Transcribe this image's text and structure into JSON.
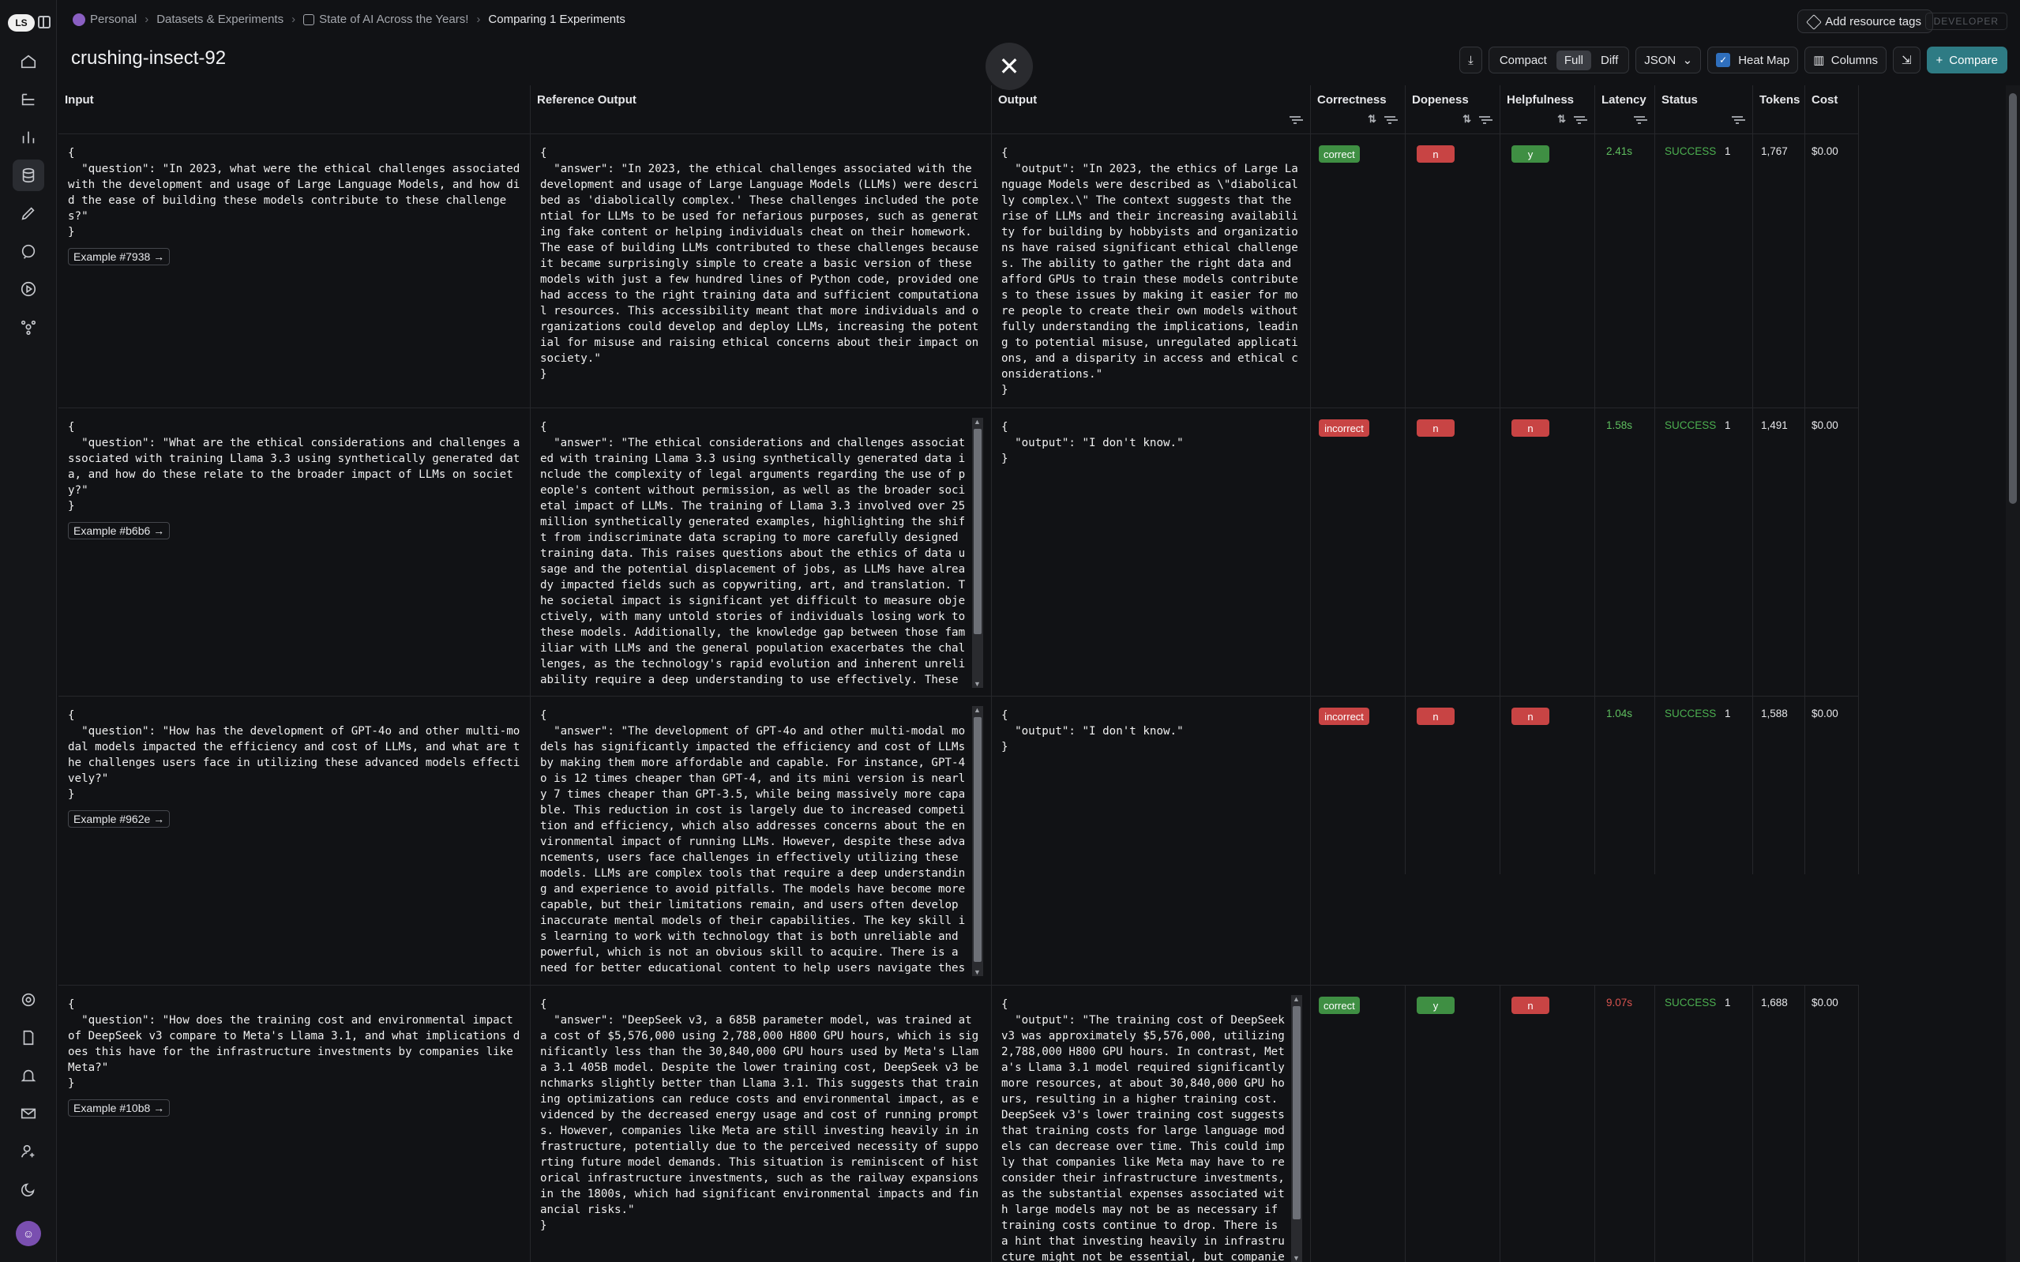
{
  "breadcrumb": {
    "workspace": "Personal",
    "section": "Datasets & Experiments",
    "dataset": "State of AI Across the Years!",
    "current": "Comparing 1 Experiments"
  },
  "header": {
    "add_tags": "Add resource tags",
    "developer": "DEVELOPER",
    "title": "crushing-insect-92"
  },
  "toolbar": {
    "compact": "Compact",
    "full": "Full",
    "diff": "Diff",
    "format": "JSON",
    "heatmap": "Heat Map",
    "columns": "Columns",
    "compare": "Compare"
  },
  "columns": {
    "input": "Input",
    "reference": "Reference Output",
    "output": "Output",
    "correctness": "Correctness",
    "dopeness": "Dopeness",
    "helpfulness": "Helpfulness",
    "latency": "Latency",
    "status": "Status",
    "tokens": "Tokens",
    "cost": "Cost"
  },
  "rows": [
    {
      "input": "{\n  \"question\": \"In 2023, what were the ethical challenges associated with the development and usage of Large Language Models, and how did the ease of building these models contribute to these challenges?\"\n}",
      "example": "Example #7938 →",
      "reference": "{\n  \"answer\": \"In 2023, the ethical challenges associated with the development and usage of Large Language Models (LLMs) were described as 'diabolically complex.' These challenges included the potential for LLMs to be used for nefarious purposes, such as generating fake content or helping individuals cheat on their homework. The ease of building LLMs contributed to these challenges because it became surprisingly simple to create a basic version of these models with just a few hundred lines of Python code, provided one had access to the right training data and sufficient computational resources. This accessibility meant that more individuals and organizations could develop and deploy LLMs, increasing the potential for misuse and raising ethical concerns about their impact on society.\"\n}",
      "output": "{\n  \"output\": \"In 2023, the ethics of Large Language Models were described as \\\"diabolically complex.\\\" The context suggests that the rise of LLMs and their increasing availability for building by hobbyists and organizations have raised significant ethical challenges. The ability to gather the right data and afford GPUs to train these models contributes to these issues by making it easier for more people to create their own models without fully understanding the implications, leading to potential misuse, unregulated applications, and a disparity in access and ethical considerations.\"\n}",
      "correctness": "correct",
      "dopeness": "n",
      "helpfulness": "y",
      "latency": "2.41s",
      "status": "SUCCESS",
      "status_count": "1",
      "tokens": "1,767",
      "cost": "$0.00"
    },
    {
      "input": "{\n  \"question\": \"What are the ethical considerations and challenges associated with training Llama 3.3 using synthetically generated data, and how do these relate to the broader impact of LLMs on society?\"\n}",
      "example": "Example #b6b6 →",
      "reference": "{\n  \"answer\": \"The ethical considerations and challenges associated with training Llama 3.3 using synthetically generated data include the complexity of legal arguments regarding the use of people's content without permission, as well as the broader societal impact of LLMs. The training of Llama 3.3 involved over 25 million synthetically generated examples, highlighting the shift from indiscriminate data scraping to more carefully designed training data. This raises questions about the ethics of data usage and the potential displacement of jobs, as LLMs have already impacted fields such as copywriting, art, and translation. The societal impact is significant yet difficult to measure objectively, with many untold stories of individuals losing work to these models. Additionally, the knowledge gap between those familiar with LLMs and the general population exacerbates the challenges, as the technology's rapid evolution and inherent unreliability require a deep understanding to use effectively. These factors underscore",
      "output": "{\n  \"output\": \"I don't know.\"\n}",
      "correctness": "incorrect",
      "dopeness": "n",
      "helpfulness": "n",
      "latency": "1.58s",
      "status": "SUCCESS",
      "status_count": "1",
      "tokens": "1,491",
      "cost": "$0.00"
    },
    {
      "input": "{\n  \"question\": \"How has the development of GPT-4o and other multi-modal models impacted the efficiency and cost of LLMs, and what are the challenges users face in utilizing these advanced models effectively?\"\n}",
      "example": "Example #962e →",
      "reference": "{\n  \"answer\": \"The development of GPT-4o and other multi-modal models has significantly impacted the efficiency and cost of LLMs by making them more affordable and capable. For instance, GPT-4o is 12 times cheaper than GPT-4, and its mini version is nearly 7 times cheaper than GPT-3.5, while being massively more capable. This reduction in cost is largely due to increased competition and efficiency, which also addresses concerns about the environmental impact of running LLMs. However, despite these advancements, users face challenges in effectively utilizing these models. LLMs are complex tools that require a deep understanding and experience to avoid pitfalls. The models have become more capable, but their limitations remain, and users often develop inaccurate mental models of their capabilities. The key skill is learning to work with technology that is both unreliable and powerful, which is not an obvious skill to acquire. There is a need for better educational content to help users navigate these challenges.\"",
      "output": "{\n  \"output\": \"I don't know.\"\n}",
      "correctness": "incorrect",
      "dopeness": "n",
      "helpfulness": "n",
      "latency": "1.04s",
      "status": "SUCCESS",
      "status_count": "1",
      "tokens": "1,588",
      "cost": "$0.00"
    },
    {
      "input": "{\n  \"question\": \"How does the training cost and environmental impact of DeepSeek v3 compare to Meta's Llama 3.1, and what implications does this have for the infrastructure investments by companies like Meta?\"\n}",
      "example": "Example #10b8 →",
      "reference": "{\n  \"answer\": \"DeepSeek v3, a 685B parameter model, was trained at a cost of $5,576,000 using 2,788,000 H800 GPU hours, which is significantly less than the 30,840,000 GPU hours used by Meta's Llama 3.1 405B model. Despite the lower training cost, DeepSeek v3 benchmarks slightly better than Llama 3.1. This suggests that training optimizations can reduce costs and environmental impact, as evidenced by the decreased energy usage and cost of running prompts. However, companies like Meta are still investing heavily in infrastructure, potentially due to the perceived necessity of supporting future model demands. This situation is reminiscent of historical infrastructure investments, such as the railway expansions in the 1800s, which had significant environmental impacts and financial risks.\"\n}",
      "output": "{\n  \"output\": \"The training cost of DeepSeek v3 was approximately $5,576,000, utilizing 2,788,000 H800 GPU hours. In contrast, Meta's Llama 3.1 model required significantly more resources, at about 30,840,000 GPU hours, resulting in a higher training cost. DeepSeek v3's lower training cost suggests that training costs for large language models can decrease over time. This could imply that companies like Meta may have to reconsider their infrastructure investments, as the substantial expenses associated with large models may not be as necessary if training costs continue to drop. There is a hint that investing heavily in infrastructure might not be essential, but companie",
      "correctness": "correct",
      "dopeness": "y",
      "helpfulness": "n",
      "latency": "9.07s",
      "status": "SUCCESS",
      "status_count": "1",
      "tokens": "1,688",
      "cost": "$0.00"
    }
  ],
  "colors": {
    "green": "#3f8f43",
    "red": "#c84444",
    "latency_good": "#5fbf5f",
    "latency_bad": "#d9534f",
    "status_ok": "#4caf50"
  }
}
